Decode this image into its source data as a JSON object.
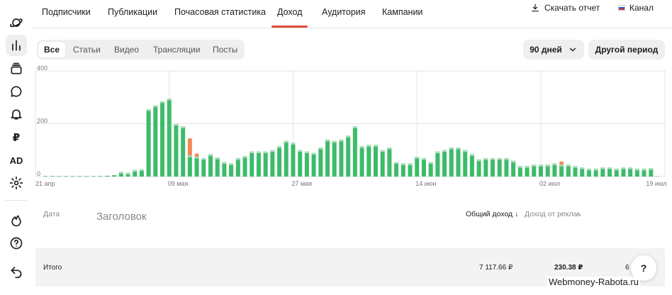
{
  "tabs": [
    {
      "label": "Подписчики",
      "active": false
    },
    {
      "label": "Публикации",
      "active": false
    },
    {
      "label": "Почасовая статистика",
      "active": false
    },
    {
      "label": "Доход",
      "active": true
    },
    {
      "label": "Аудитория",
      "active": false
    },
    {
      "label": "Кампании",
      "active": false
    }
  ],
  "header_actions": {
    "download_label": "Скачать отчет",
    "channel_label": "Канал"
  },
  "sidebar": {
    "items": [
      {
        "icon": "planet-icon"
      },
      {
        "icon": "bar-chart-icon",
        "active": true
      },
      {
        "icon": "layers-icon"
      },
      {
        "icon": "chat-bubble-icon"
      },
      {
        "icon": "bell-icon"
      },
      {
        "icon": "ruble-icon",
        "text": "₽"
      },
      {
        "icon": "ad-icon",
        "text": "AD"
      },
      {
        "icon": "gear-icon"
      },
      {
        "icon": "fire-icon"
      },
      {
        "icon": "help-circle-icon"
      },
      {
        "icon": "undo-icon"
      }
    ]
  },
  "filters": {
    "types": [
      "Все",
      "Статьи",
      "Видео",
      "Трансляции",
      "Посты"
    ],
    "active_type": "Все",
    "period_label": "90 дней",
    "custom_period_label": "Другой период"
  },
  "chart_data": {
    "type": "bar",
    "stacked": true,
    "ylim": [
      0,
      400
    ],
    "yticks": [
      0,
      200,
      400
    ],
    "grid": true,
    "xtick_labels": [
      {
        "index": 0,
        "label": "21 апр"
      },
      {
        "index": 18,
        "label": "09 мая"
      },
      {
        "index": 36,
        "label": "27 мая"
      },
      {
        "index": 54,
        "label": "14 июн"
      },
      {
        "index": 72,
        "label": "02 июл"
      },
      {
        "index": 89,
        "label": "19 июл"
      }
    ],
    "colors": {
      "main": "#3dbb6a",
      "top": "#a9dfb9",
      "secondary": "#f08a55"
    },
    "series": [
      {
        "values": [
          2,
          2,
          2,
          2,
          2,
          2,
          2,
          2,
          2,
          3,
          5,
          18,
          15,
          25,
          28,
          255,
          270,
          285,
          295,
          200,
          190,
          80,
          75,
          70,
          85,
          72,
          55,
          50,
          70,
          78,
          95,
          95,
          95,
          100,
          115,
          135,
          128,
          100,
          95,
          90,
          110,
          140,
          135,
          140,
          155,
          190,
          115,
          120,
          120,
          100,
          110,
          55,
          50,
          50,
          75,
          70,
          55,
          95,
          100,
          110,
          110,
          100,
          85,
          65,
          70,
          70,
          70,
          70,
          60,
          40,
          40,
          45,
          45,
          45,
          50,
          45,
          45,
          40,
          35,
          30,
          30,
          35,
          35,
          30,
          35,
          35,
          30,
          30,
          32,
          1
        ]
      },
      {
        "values": [
          0,
          0,
          0,
          0,
          0,
          0,
          0,
          0,
          0,
          0,
          0,
          0,
          0,
          0,
          0,
          0,
          0,
          0,
          0,
          0,
          0,
          65,
          12,
          0,
          0,
          0,
          0,
          0,
          0,
          0,
          0,
          0,
          0,
          0,
          0,
          0,
          0,
          0,
          0,
          0,
          0,
          0,
          0,
          0,
          0,
          0,
          0,
          0,
          0,
          0,
          0,
          0,
          0,
          0,
          0,
          0,
          0,
          0,
          0,
          0,
          0,
          0,
          0,
          0,
          0,
          0,
          0,
          0,
          0,
          0,
          0,
          0,
          0,
          0,
          0,
          12,
          0,
          0,
          0,
          0,
          0,
          0,
          0,
          0,
          0,
          0,
          0,
          0,
          0,
          0
        ]
      }
    ]
  },
  "table": {
    "columns": {
      "date": "Дата",
      "title": "Заголовок",
      "total_income": "Общий доход",
      "ad_income": "Доход от рекламы"
    },
    "total_row": {
      "label": "Итого",
      "total_income": "7 117.66 ₽",
      "ad_income": "230.38 ₽",
      "partial": "6"
    }
  },
  "help_button_label": "?",
  "watermark": "Webmoney-Rabota.ru"
}
